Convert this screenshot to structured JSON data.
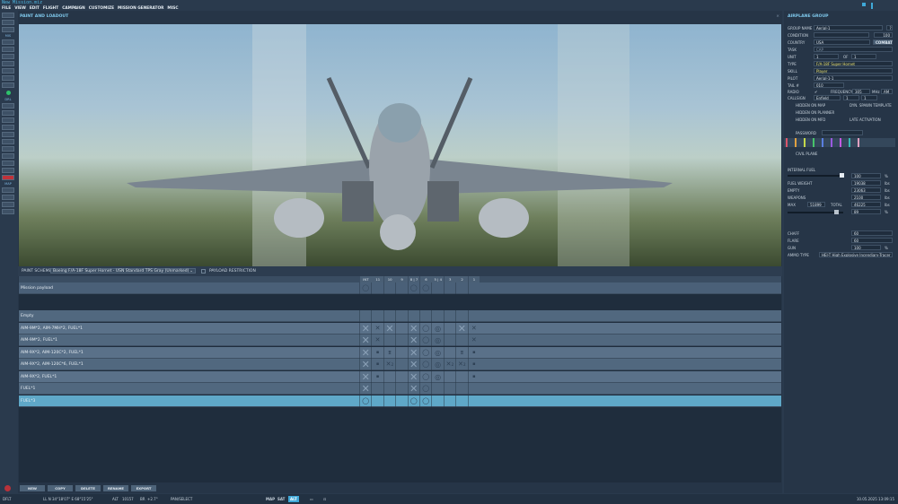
{
  "window": {
    "title": "New Mission.miz"
  },
  "menu": [
    "FILE",
    "VIEW",
    "EDIT",
    "FLIGHT",
    "CAMPAIGN",
    "CUSTOMIZE",
    "MISSION GENERATOR",
    "MISC"
  ],
  "toolbar": {
    "labels": [
      "MIS",
      "DRL",
      "MAP"
    ]
  },
  "panel": {
    "title": "PAINT AND LOADOUT",
    "paint_scheme_label": "PAINT SCHEME",
    "paint_scheme_value": "Boeing F/A-18F Super Hornet - USN Standard TPS Gray (Unmarked)",
    "payload_restriction": "PAYLOAD RESTRICTION"
  },
  "pylons": [
    "INT",
    "11",
    "10",
    "9",
    "8 | 7",
    "6",
    "5 | 4",
    "3",
    "2",
    "1"
  ],
  "mission_payload": {
    "name": "Mission payload",
    "cells": [
      "O",
      "",
      "",
      "",
      "O",
      "O",
      "",
      "",
      "",
      ""
    ]
  },
  "loadouts": [
    {
      "name": "Empty",
      "cells": [
        "",
        "",
        "",
        "",
        "",
        "",
        "",
        "",
        "",
        ""
      ]
    },
    {
      "name": "AIM-9M*2, AIM-7MH*2, FUEL*1",
      "cells": [
        "X",
        "x",
        "X",
        "",
        "X",
        "O",
        "@",
        "",
        "X",
        "x"
      ]
    },
    {
      "name": "AIM-9M*2, FUEL*1",
      "cells": [
        "X",
        "x",
        "",
        "",
        "X",
        "O",
        "@",
        "",
        "",
        "x"
      ]
    },
    {
      "name": "AIM-9X*2, AIM-120C*2, FUEL*1",
      "cells": [
        "X",
        "•",
        "=",
        "",
        "X",
        "O",
        "@",
        "",
        "=",
        "•"
      ]
    },
    {
      "name": "AIM-9X*2, AIM-120C*6, FUEL*1",
      "cells": [
        "X",
        "•",
        "x₂",
        "",
        "X",
        "O",
        "@",
        "x₂",
        "x₂",
        "•"
      ]
    },
    {
      "name": "AIM-9X*2, FUEL*1",
      "cells": [
        "X",
        "•",
        "",
        "",
        "X",
        "O",
        "@",
        "",
        "",
        "•"
      ]
    },
    {
      "name": "FUEL*1",
      "cells": [
        "X",
        "",
        "",
        "",
        "X",
        "O",
        "",
        "",
        "",
        ""
      ]
    },
    {
      "name": "FUEL*3",
      "cells": [
        "O",
        "",
        "",
        "",
        "O",
        "O",
        "",
        "",
        "",
        ""
      ],
      "selected": true
    }
  ],
  "buttons": [
    "NEW",
    "COPY",
    "DELETE",
    "RENAME",
    "EXPORT"
  ],
  "status": {
    "mode": "DFLT",
    "coords": "LL  N 34°18'07\"  E 68°15'25\"",
    "alt_label": "ALT",
    "alt": "10157",
    "bra_label": "BR",
    "bra": "+2.7°",
    "action": "PAN/SELECT",
    "map_btns": [
      "MAP",
      "SAT",
      "ALT"
    ],
    "datetime": "10.05.2025 13:09:15"
  },
  "group": {
    "title": "AIRPLANE GROUP",
    "group_name_label": "GROUP NAME",
    "group_name": "Aerial-1",
    "condition_label": "CONDITION",
    "condition": "100",
    "country_label": "COUNTRY",
    "country": "USA",
    "combat": "COMBAT",
    "task_label": "TASK",
    "task": "CAP",
    "unit_label": "UNIT",
    "unit": "1",
    "of": "OF",
    "unit_total": "1",
    "type_label": "TYPE",
    "type": "F/A-18F Super Hornet",
    "skill_label": "SKILL",
    "skill": "Player",
    "pilot_label": "PILOT",
    "pilot": "Aerial-1-1",
    "tail_label": "TAIL #",
    "tail": "010",
    "radio_label": "RADIO",
    "frequency_label": "FREQUENCY",
    "frequency": "305",
    "mhz": "MHz",
    "am": "AM",
    "callsign_label": "CALLSIGN",
    "callsign": "Enfield",
    "cs1": "1",
    "cs2": "1",
    "hidden_map": "HIDDEN ON MAP",
    "dyn_spawn": "DYN. SPAWN TEMPLATE",
    "hidden_planner": "HIDDEN ON PLANNER",
    "hidden_mfd": "HIDDEN ON MFD",
    "late_activation": "LATE ACTIVATION",
    "password": "PASSWORD",
    "civil_plane": "CIVIL PLANE"
  },
  "fuel": {
    "internal_label": "INTERNAL FUEL",
    "internal_pct": 100,
    "internal": "100",
    "fuel_weight_label": "FUEL WEIGHT",
    "fuel_weight": "19038",
    "empty_label": "EMPTY",
    "empty": "23063",
    "weapons_label": "WEAPONS",
    "weapons": "2100",
    "max_label": "MAX",
    "max": "51899",
    "total_label": "TOTAL",
    "total": "46225",
    "load_pct": "89",
    "pct": "%",
    "lbs": "lbs"
  },
  "counter": {
    "chaff_label": "CHAFF",
    "chaff": "60",
    "flare_label": "FLARE",
    "flare": "60",
    "gun_label": "GUN",
    "gun": "100",
    "ammo_label": "AMMO TYPE",
    "ammo": "HEI-T High Explosive Incendiary-Tracer"
  }
}
